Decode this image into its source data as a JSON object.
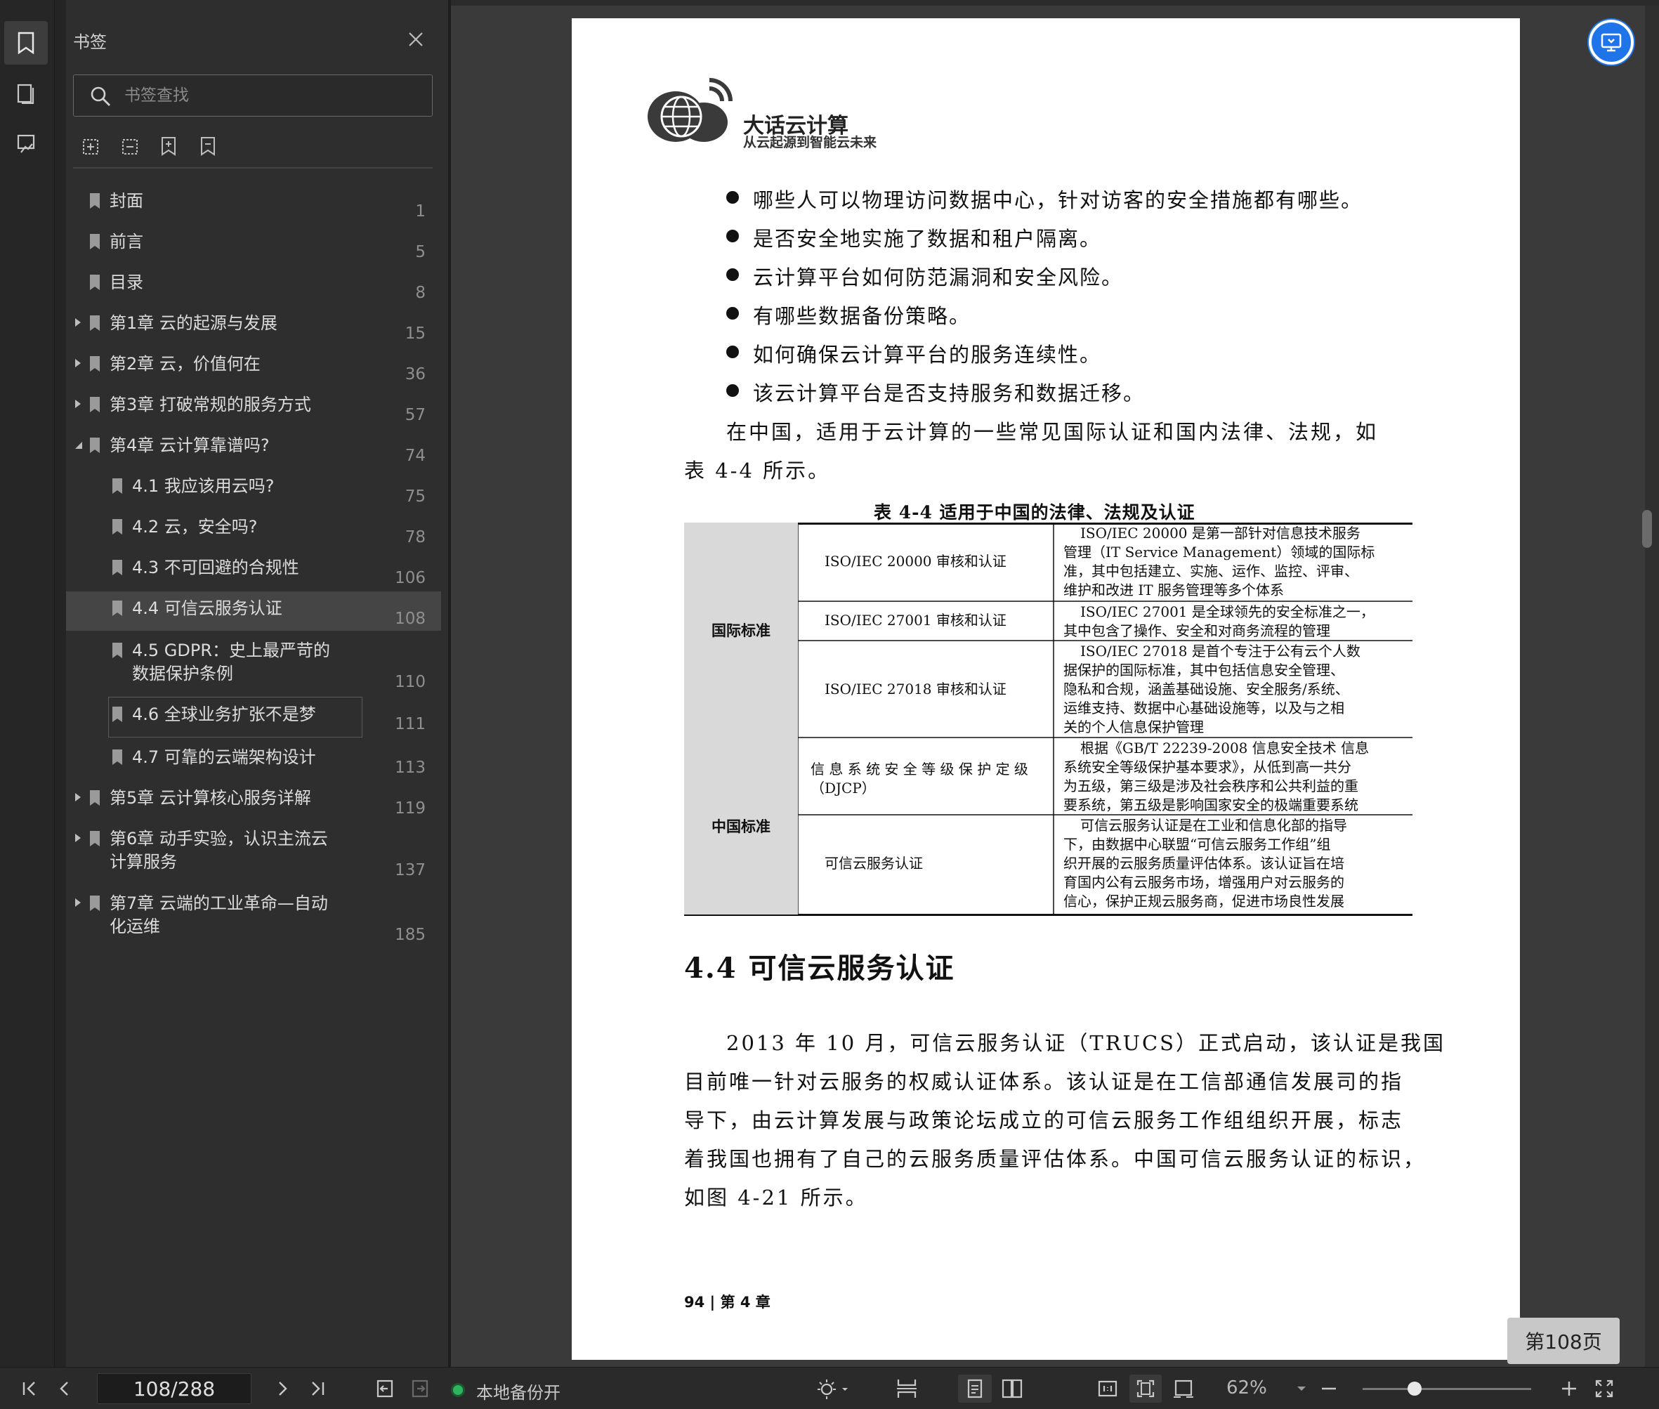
{
  "panel": {
    "title": "书签",
    "search_placeholder": "书签查找"
  },
  "bookmarks": [
    {
      "label": "封面",
      "page": "1"
    },
    {
      "label": "前言",
      "page": "5"
    },
    {
      "label": "目录",
      "page": "8"
    },
    {
      "label": "第1章  云的起源与发展",
      "page": "15"
    },
    {
      "label": "第2章  云，价值何在",
      "page": "36"
    },
    {
      "label": "第3章  打破常规的服务方式",
      "page": "57"
    },
    {
      "label": "第4章  云计算靠谱吗?",
      "page": "74"
    },
    {
      "label": "4.1 我应该用云吗?",
      "page": "75"
    },
    {
      "label": "4.2 云，安全吗?",
      "page": "78"
    },
    {
      "label": "4.3 不可回避的合规性",
      "page": "106"
    },
    {
      "label": "4.4 可信云服务认证",
      "page": "108"
    },
    {
      "label": "4.5 GDPR：史上最严苛的\n数据保护条例",
      "page": "110"
    },
    {
      "label": "4.6 全球业务扩张不是梦",
      "page": "111"
    },
    {
      "label": "4.7 可靠的云端架构设计",
      "page": "113"
    },
    {
      "label": "第5章  云计算核心服务详解",
      "page": "119"
    },
    {
      "label": "第6章  动手实验，认识主流云\n计算服务",
      "page": "137"
    },
    {
      "label": "第7章  云端的工业革命—自动\n化运维",
      "page": "185"
    }
  ],
  "document": {
    "logo_title": "大话云计算",
    "logo_subtitle": "从云起源到智能云未来",
    "bullets": [
      "哪些人可以物理访问数据中心，针对访客的安全措施都有哪些。",
      "是否安全地实施了数据和租户隔离。",
      "云计算平台如何防范漏洞和安全风险。",
      "有哪些数据备份策略。",
      "如何确保云计算平台的服务连续性。",
      "该云计算平台是否支持服务和数据迁移。"
    ],
    "intro_line1": "在中国，适用于云计算的一些常见国际认证和国内法律、法规，如",
    "intro_line2": "表 4-4 所示。",
    "table_caption": "表 4-4   适用于中国的法律、法规及认证",
    "table": {
      "group_intl": "国际标准",
      "group_cn": "中国标准",
      "rows": [
        {
          "name": "ISO/IEC 20000  审核和认证",
          "desc": "ISO/IEC  20000  是第一部针对信息技术服务\n管理（IT Service Management）领域的国际标\n准，其中包括建立、实施、运作、监控、评审、\n维护和改进 IT 服务管理等多个体系"
        },
        {
          "name": "ISO/IEC 27001  审核和认证",
          "desc": "ISO/IEC 27001  是全球领先的安全标准之一，\n其中包含了操作、安全和对商务流程的管理"
        },
        {
          "name": "ISO/IEC 27018  审核和认证",
          "desc": "ISO/IEC  27018  是首个专注于公有云个人数\n据保护的国际标准，其中包括信息安全管理、\n隐私和合规，涵盖基础设施、安全服务/系统、\n运维支持、数据中心基础设施等，以及与之相\n关的个人信息保护管理"
        },
        {
          "name": "信 息 系 统 安 全 等 级 保 护 定 级\n（DJCP）",
          "desc": "根据《GB/T  22239-2008  信息安全技术  信息\n系统安全等级保护基本要求》，从低到高一共分\n为五级，第三级是涉及社会秩序和公共利益的重\n要系统，第五级是影响国家安全的极端重要系统"
        },
        {
          "name": "可信云服务认证",
          "desc": "可信云服务认证是在工业和信息化部的指导\n下，由数据中心联盟“可信云服务工作组”组\n织开展的云服务质量评估体系。该认证旨在培\n育国内公有云服务市场，增强用户对云服务的\n信心，保护正规云服务商，促进市场良性发展"
        }
      ]
    },
    "section_title": "4.4    可信云服务认证",
    "body_lines": [
      "2013 年 10 月，可信云服务认证（TRUCS）正式启动，该认证是我国",
      "目前唯一针对云服务的权威认证体系。该认证是在工信部通信发展司的指",
      "导下，由云计算发展与政策论坛成立的可信云服务工作组组织开展，标志",
      "着我国也拥有了自己的云服务质量评估体系。中国可信云服务认证的标识，",
      "如图 4-21 所示。"
    ],
    "footer": "94 | 第 4 章"
  },
  "page_badge": "第108页",
  "statusbar": {
    "page_value": "108/288",
    "backup_label": "本地备份开",
    "zoom_label": "62%"
  },
  "colors": {
    "accent": "#1e74e8",
    "backup_on": "#2db55d",
    "selected_bg": "#454545"
  }
}
